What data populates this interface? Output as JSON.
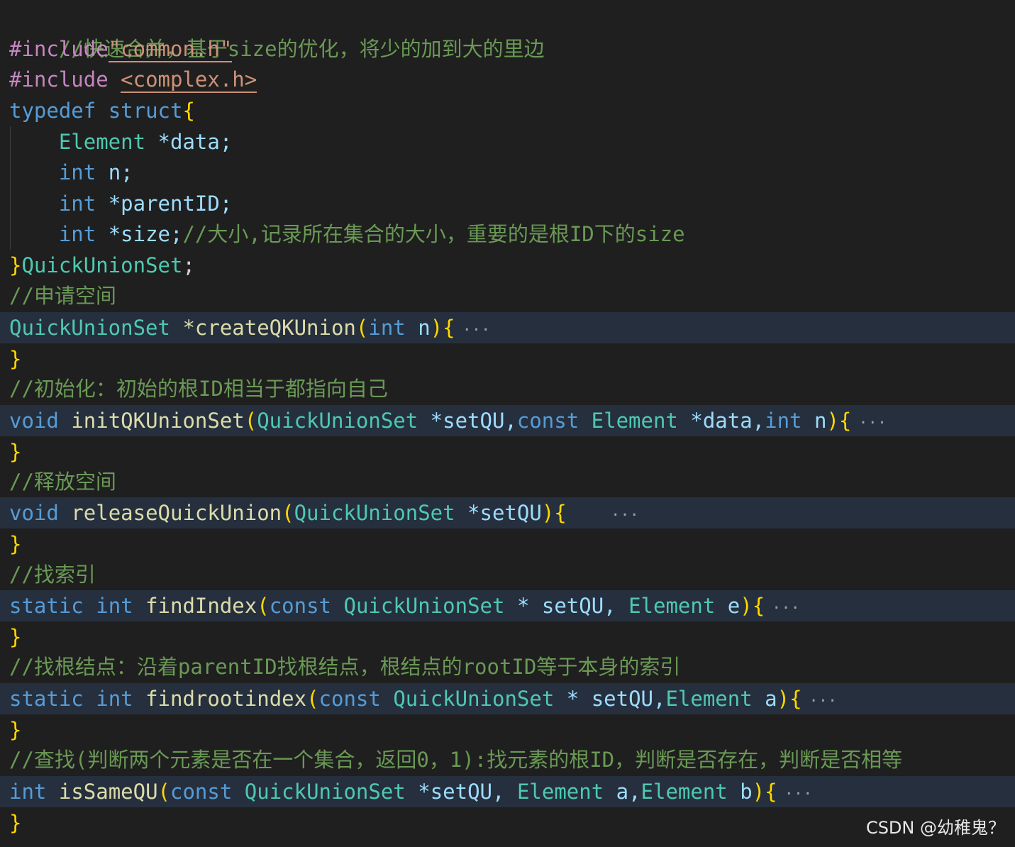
{
  "editor": {
    "language": "c",
    "theme_colors": {
      "background": "#1f1f1f",
      "folded_line": "#262f3d",
      "comment": "#6a9955",
      "keyword": "#569cd6",
      "type": "#4ec9b0",
      "function": "#dcdcaa",
      "variable": "#9cdcfe",
      "string": "#ce9178",
      "preprocessor": "#c586c0",
      "bracket": "#ffd700"
    },
    "lines": {
      "l1_comment": "//快速合并，基于size的优化，将少的加到大的里边",
      "l2_directive": "#include",
      "l2_file": "\"common.h\"",
      "l3_directive": "#include",
      "l3_file": "<complex.h>",
      "l4_kw1": "typedef",
      "l4_kw2": "struct",
      "l4_brace": "{",
      "l5_type": "Element",
      "l5_rest": "*data;",
      "l6_type": "int",
      "l6_rest": "n;",
      "l7_type": "int",
      "l7_rest": "*parentID;",
      "l8_type": "int",
      "l8_rest": "*size;",
      "l8_comment": "//大小,记录所在集合的大小，重要的是根ID下的size",
      "l9_brace": "}",
      "l9_name": "QuickUnionSet",
      "l9_semi": ";",
      "l10_comment": "//申请空间",
      "l11_type": "QuickUnionSet",
      "l11_fn": "*createQKUnion",
      "l11_param_type": "int",
      "l11_param": "n",
      "l12_brace": "}",
      "l13_comment": "//初始化：初始的根ID相当于都指向自己",
      "l14_kw": "void",
      "l14_fn": "initQKUnionSet",
      "l14_t1": "QuickUnionSet",
      "l14_p1": "*setQU,",
      "l14_kw2": "const",
      "l14_t2": "Element",
      "l14_p2": "*data,",
      "l14_t3": "int",
      "l14_p3": "n",
      "l15_brace": "}",
      "l16_comment": "//释放空间",
      "l17_kw": "void",
      "l17_fn": "releaseQuickUnion",
      "l17_t1": "QuickUnionSet",
      "l17_p1": "*setQU",
      "l18_brace": "}",
      "l19_comment": "//找索引",
      "l20_kw": "static",
      "l20_kw2": "int",
      "l20_fn": "findIndex",
      "l20_kw3": "const",
      "l20_t1": "QuickUnionSet",
      "l20_p1": "* setQU,",
      "l20_t2": "Element",
      "l20_p2": "e",
      "l21_brace": "}",
      "l22_comment": "//找根结点：沿着parentID找根结点，根结点的rootID等于本身的索引",
      "l23_kw": "static",
      "l23_kw2": "int",
      "l23_fn": "findrootindex",
      "l23_kw3": "const",
      "l23_t1": "QuickUnionSet",
      "l23_p1": "* setQU,",
      "l23_t2": "Element",
      "l23_p2": "a",
      "l24_brace": "}",
      "l25_comment": "//查找(判断两个元素是否在一个集合，返回0，1):找元素的根ID，判断是否存在，判断是否相等",
      "l26_kw": "int",
      "l26_fn": "isSameQU",
      "l26_kw2": "const",
      "l26_t1": "QuickUnionSet",
      "l26_p1": "*setQU,",
      "l26_t2": "Element",
      "l26_p2": "a,",
      "l26_t3": "Element",
      "l26_p3": "b",
      "l27_brace": "}"
    },
    "fold_ellipsis": "···"
  },
  "watermark": "CSDN @幼稚鬼？"
}
